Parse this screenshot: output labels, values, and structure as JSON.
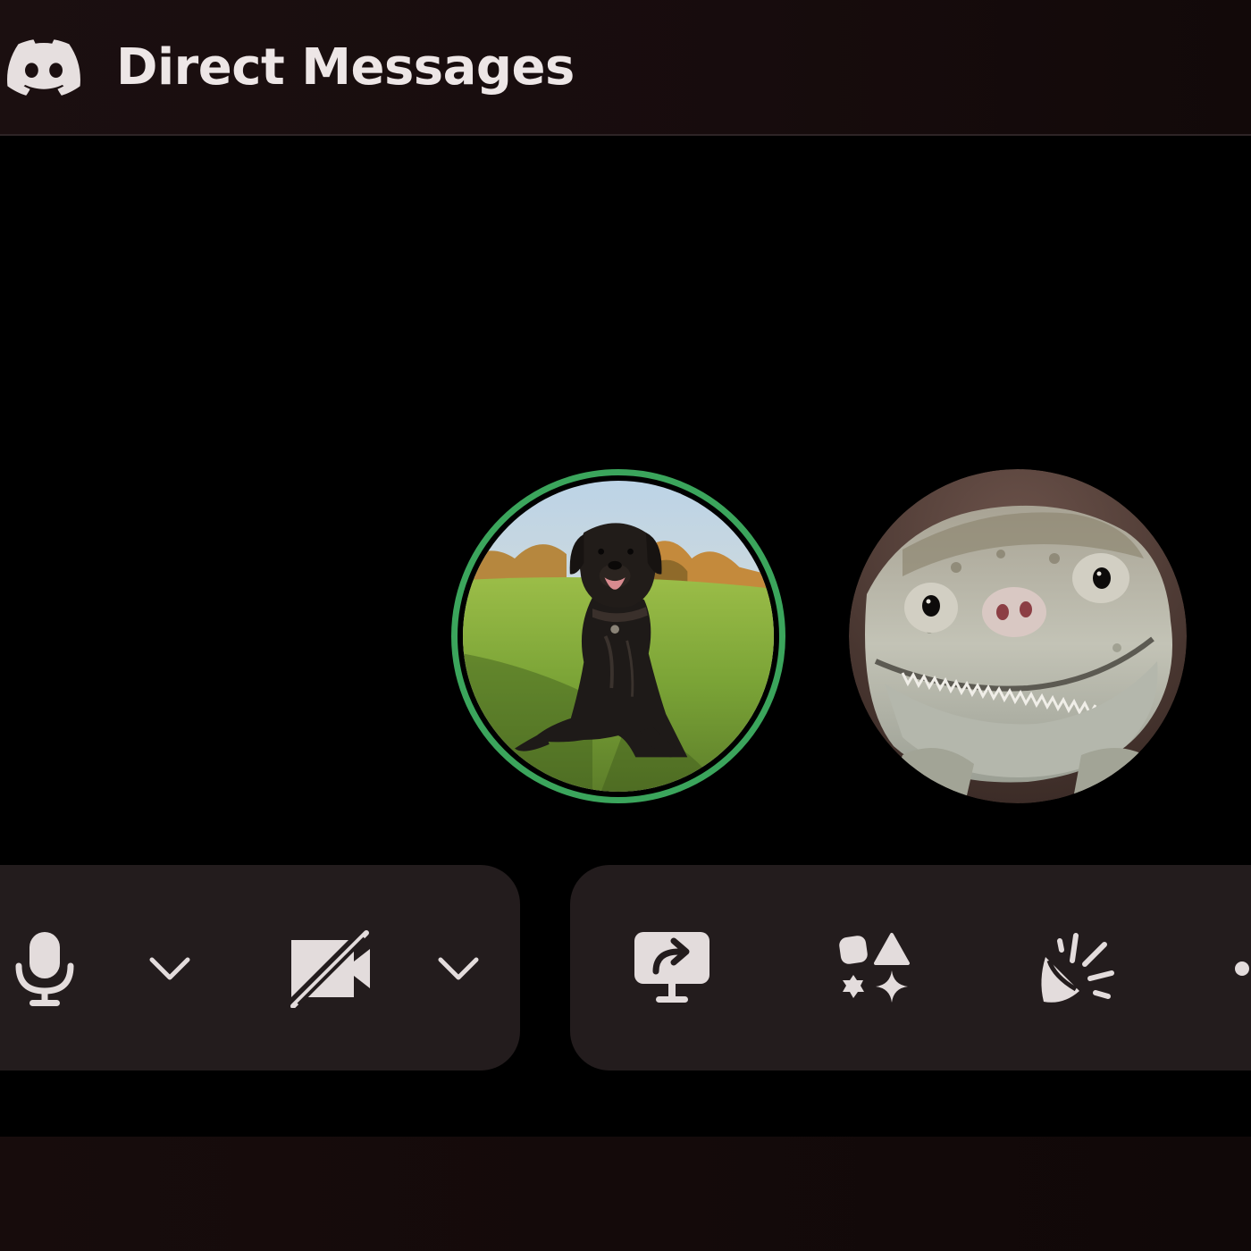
{
  "window": {
    "title": "Direct Messages",
    "logo_icon": "discord-logo-icon"
  },
  "call": {
    "participants": [
      {
        "avatar": "dog-avatar",
        "speaking": true,
        "speaking_ring_color": "#3ba55c"
      },
      {
        "avatar": "lizard-avatar",
        "speaking": false
      }
    ]
  },
  "controls": {
    "left_group": [
      {
        "icon": "microphone-icon"
      },
      {
        "icon": "chevron-down-icon"
      },
      {
        "icon": "camera-off-icon"
      },
      {
        "icon": "chevron-down-icon"
      }
    ],
    "right_group": [
      {
        "icon": "screen-share-icon"
      },
      {
        "icon": "activities-icon"
      },
      {
        "icon": "soundboard-icon"
      },
      {
        "icon": "more-icon"
      }
    ]
  },
  "colors": {
    "background": "#000000",
    "panel": "#231c1d",
    "icon": "#e3dcdc",
    "speaking": "#3ba55c"
  }
}
